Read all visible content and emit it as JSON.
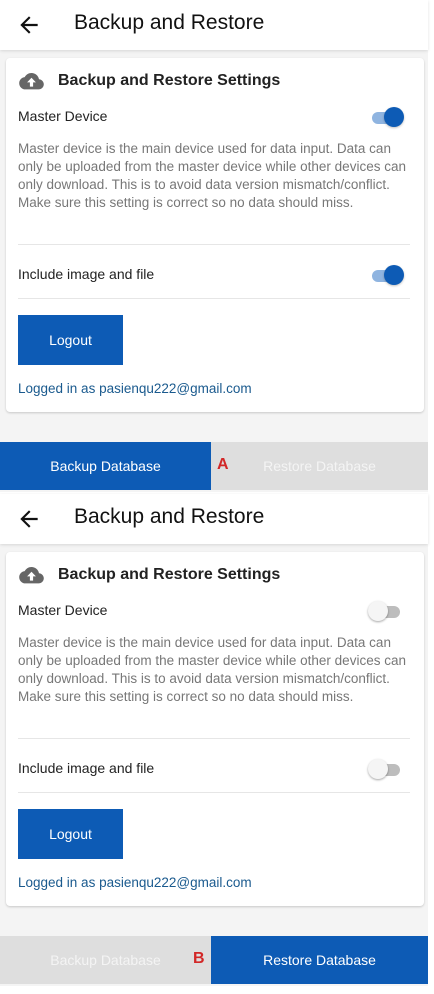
{
  "colors": {
    "primary": "#0d5bb5",
    "marker": "#d22828",
    "inactive_tab": "#dedede"
  },
  "panels": [
    {
      "header": {
        "title": "Backup and Restore",
        "back_icon": "arrow-left-icon"
      },
      "card": {
        "icon": "cloud-upload-icon",
        "title": "Backup and Restore Settings",
        "master_label": "Master Device",
        "master_on": true,
        "description": "Master device is the main device used for data input. Data can only be uploaded from the master device while other devices can only download. This is to avoid data version mismatch/conflict. Make sure this setting is correct so no data should miss.",
        "include_label": "Include image and file",
        "include_on": true,
        "logout_label": "Logout",
        "logged_in": "Logged in as pasienqu222@gmail.com"
      },
      "tabs": {
        "backup": "Backup Database",
        "restore": "Restore Database",
        "active": "backup"
      },
      "marker": "A"
    },
    {
      "header": {
        "title": "Backup and Restore",
        "back_icon": "arrow-left-icon"
      },
      "card": {
        "icon": "cloud-upload-icon",
        "title": "Backup and Restore Settings",
        "master_label": "Master Device",
        "master_on": false,
        "description": "Master device is the main device used for data input. Data can only be uploaded from the master device while other devices can only download. This is to avoid data version mismatch/conflict. Make sure this setting is correct so no data should miss.",
        "include_label": "Include image and file",
        "include_on": false,
        "logout_label": "Logout",
        "logged_in": "Logged in as pasienqu222@gmail.com"
      },
      "tabs": {
        "backup": "Backup Database",
        "restore": "Restore Database",
        "active": "restore"
      },
      "marker": "B"
    }
  ]
}
